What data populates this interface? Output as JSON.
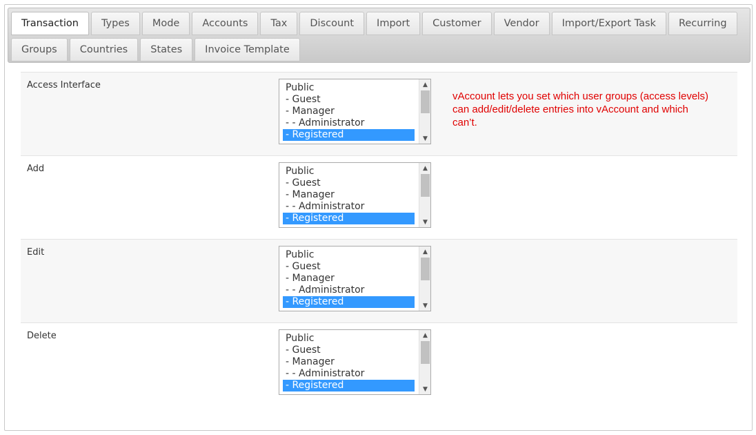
{
  "tabs_row1": [
    "Transaction",
    "Types",
    "Mode",
    "Accounts",
    "Tax",
    "Discount",
    "Import",
    "Customer",
    "Vendor",
    "Import/Export Task",
    "Recurring"
  ],
  "tabs_row2": [
    "Groups",
    "Countries",
    "States",
    "Invoice Template"
  ],
  "active_tab": "Transaction",
  "note": "vAccount lets you set which user groups (access levels) can add/edit/delete entries into vAccount and which can’t.",
  "options": [
    "Public",
    "- Guest",
    "- Manager",
    "- - Administrator",
    "- Registered"
  ],
  "selected_option": "- Registered",
  "rows": [
    {
      "label": "Access Interface"
    },
    {
      "label": "Add"
    },
    {
      "label": "Edit"
    },
    {
      "label": "Delete"
    }
  ],
  "icons": {
    "scroll_up": "chevron-up-icon",
    "scroll_down": "chevron-down-icon"
  },
  "colors": {
    "selection": "#3399ff",
    "note": "#e00000"
  }
}
